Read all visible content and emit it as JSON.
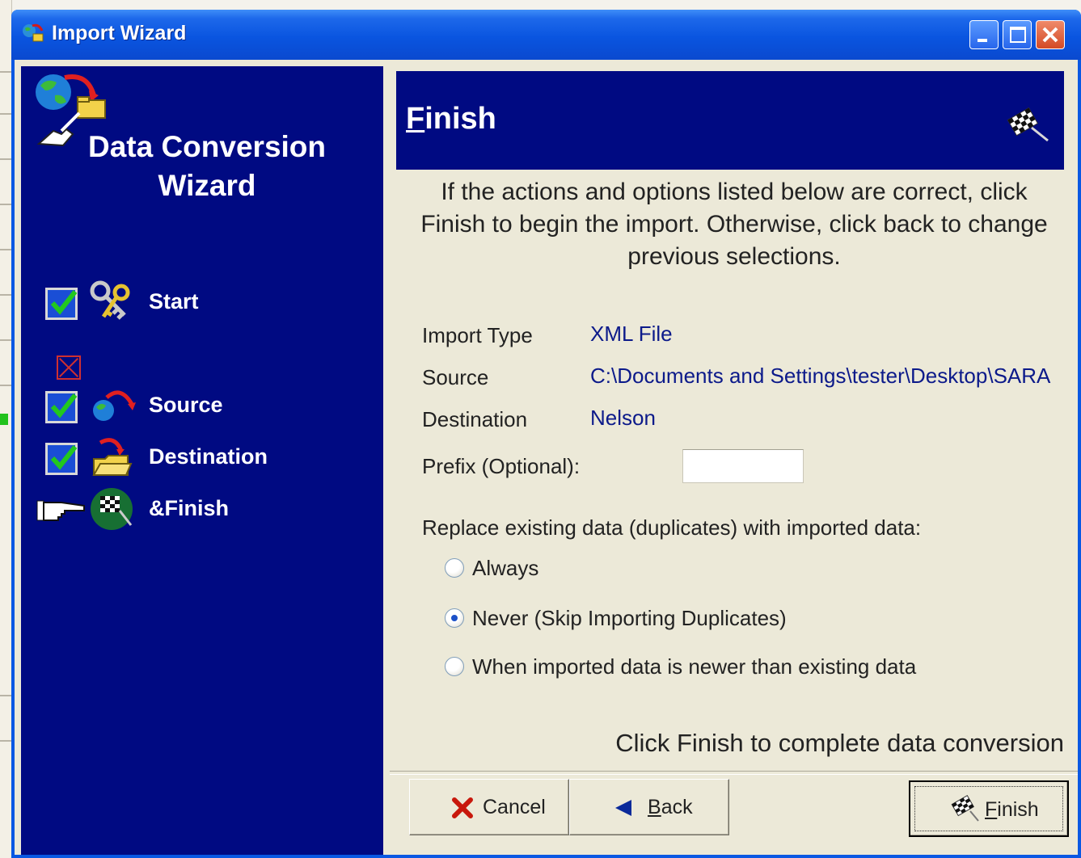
{
  "window": {
    "title": "Import Wizard"
  },
  "sidebar": {
    "title_line1": "Data Conversion",
    "title_line2": "Wizard",
    "steps": [
      {
        "label": "Start",
        "status": "checked",
        "icon": "keys-icon"
      },
      {
        "label": "",
        "status": "unchecked",
        "icon": ""
      },
      {
        "label": "Source",
        "status": "checked",
        "icon": "globe-arrow-icon"
      },
      {
        "label": "Destination",
        "status": "checked",
        "icon": "folder-arrow-icon"
      },
      {
        "label": "&Finish",
        "status": "current",
        "icon": "checkered-flag-icon"
      }
    ]
  },
  "header": {
    "title_first": "F",
    "title_rest": "inish",
    "icon": "checkered-flag-icon"
  },
  "intro_text": "If the actions and options listed below are correct, click Finish to begin the import. Otherwise, click back to change previous selections.",
  "summary": {
    "import_type_label": "Import Type",
    "import_type_value": "XML File",
    "source_label": "Source",
    "source_value": "C:\\Documents and Settings\\tester\\Desktop\\SARA",
    "destination_label": "Destination",
    "destination_value": "Nelson"
  },
  "prefix": {
    "label": "Prefix (Optional):",
    "value": ""
  },
  "replace": {
    "label": "Replace existing data (duplicates) with imported data:",
    "options": [
      {
        "label": "Always",
        "selected": false
      },
      {
        "label": "Never (Skip Importing Duplicates)",
        "selected": true
      },
      {
        "label": "When imported data is newer than existing data",
        "selected": false
      }
    ]
  },
  "footnote": "Click Finish to complete data conversion",
  "buttons": {
    "cancel_label": "Cancel",
    "back_first": "B",
    "back_rest": "ack",
    "finish_first": "F",
    "finish_rest": "inish"
  },
  "colors": {
    "navy_panel": "#000a82",
    "titlebar": "#0a55e0",
    "value_text": "#0c1a8a",
    "dialog_bg": "#ece9d8"
  }
}
